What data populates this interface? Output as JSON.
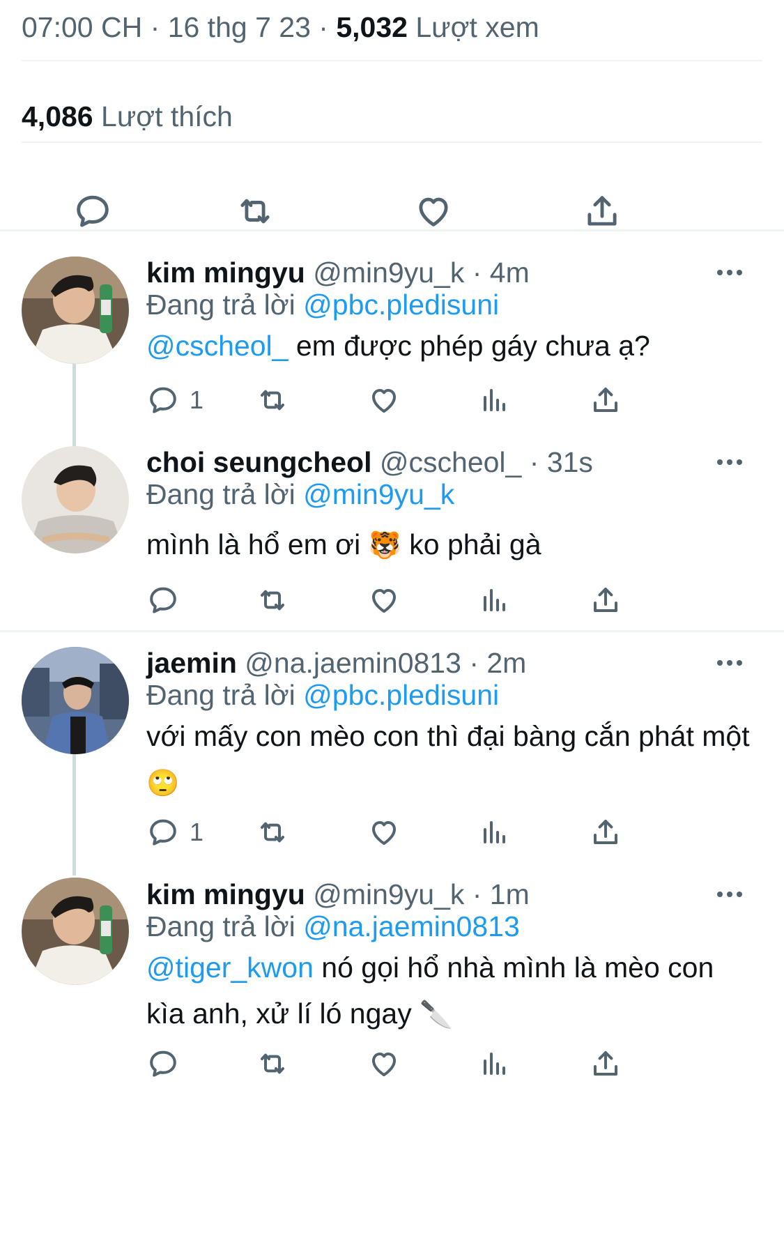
{
  "tweet_meta": {
    "time": "07:00 CH",
    "sep": "·",
    "date": "16 thg 7 23",
    "views_count": "5,032",
    "views_label": "Lượt xem"
  },
  "likes": {
    "count": "4,086",
    "label": "Lượt thích"
  },
  "colors": {
    "text": "#0f1419",
    "secondary": "#536471",
    "link": "#1d9bf0",
    "divider": "#eff3f4",
    "thread_line": "#cfd9de"
  },
  "main_actions": [
    "reply-icon",
    "retweet-icon",
    "like-icon",
    "share-icon"
  ],
  "replies": [
    {
      "name": "kim mingyu",
      "handle": "@min9yu_k",
      "sep": "·",
      "time": "4m",
      "replying_prefix": "Đang trả lời",
      "replying_to": "@pbc.pledisuni",
      "mention": "@cscheol_",
      "text": " em được phép gáy chưa ạ?",
      "reply_count": "1"
    },
    {
      "name": "choi seungcheol",
      "handle": "@cscheol_",
      "sep": "·",
      "time": "31s",
      "replying_prefix": "Đang trả lời",
      "replying_to": "@min9yu_k",
      "text_before": "mình là hổ em ơi ",
      "emoji": "🐯",
      "text_after": " ko phải gà",
      "reply_count": ""
    },
    {
      "name": "jaemin",
      "handle": "@na.jaemin0813",
      "sep": "·",
      "time": "2m",
      "replying_prefix": "Đang trả lời",
      "replying_to": "@pbc.pledisuni",
      "text_before": "với mấy con mèo con thì đại bàng cắn phát một ",
      "emoji": "🙄",
      "reply_count": "1"
    },
    {
      "name": "kim mingyu",
      "handle": "@min9yu_k",
      "sep": "·",
      "time": "1m",
      "replying_prefix": "Đang trả lời",
      "replying_to": "@na.jaemin0813",
      "mention": "@tiger_kwon",
      "text": " nó gọi hổ nhà mình là mèo con kìa anh, xử lí ló ngay ",
      "emoji": "🔪",
      "reply_count": ""
    }
  ]
}
